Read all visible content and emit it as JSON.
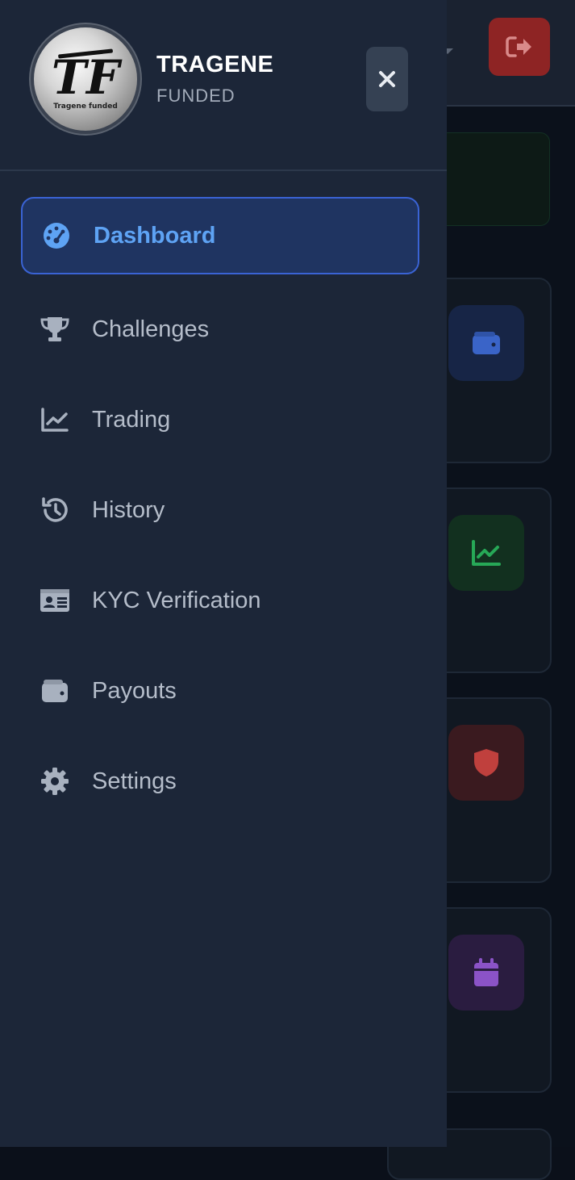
{
  "brand": {
    "name": "TRAGENE",
    "subtitle": "FUNDED",
    "logo_monogram": "TF",
    "logo_caption": "Tragene funded"
  },
  "nav": {
    "items": [
      {
        "label": "Dashboard",
        "icon": "gauge-icon",
        "active": true
      },
      {
        "label": "Challenges",
        "icon": "trophy-icon",
        "active": false
      },
      {
        "label": "Trading",
        "icon": "line-chart-icon",
        "active": false
      },
      {
        "label": "History",
        "icon": "history-icon",
        "active": false
      },
      {
        "label": "KYC Verification",
        "icon": "id-card-icon",
        "active": false
      },
      {
        "label": "Payouts",
        "icon": "wallet-icon",
        "active": false
      },
      {
        "label": "Settings",
        "icon": "gear-icon",
        "active": false
      }
    ]
  },
  "background": {
    "logout_icon": "logout-icon",
    "cards": [
      {
        "icon": "wallet-icon",
        "color": "#3a64c8"
      },
      {
        "icon": "line-chart-icon",
        "color": "#27a857"
      },
      {
        "icon": "shield-icon",
        "color": "#c0403d"
      },
      {
        "icon": "calendar-icon",
        "color": "#8b53c7"
      }
    ]
  },
  "colors": {
    "drawer_bg": "#1c2638",
    "active_bg": "#1f3461",
    "active_border": "#3a63d4",
    "active_text": "#5ea3f4",
    "nav_text": "#b5bdca",
    "logout_bg": "#8e2424"
  }
}
